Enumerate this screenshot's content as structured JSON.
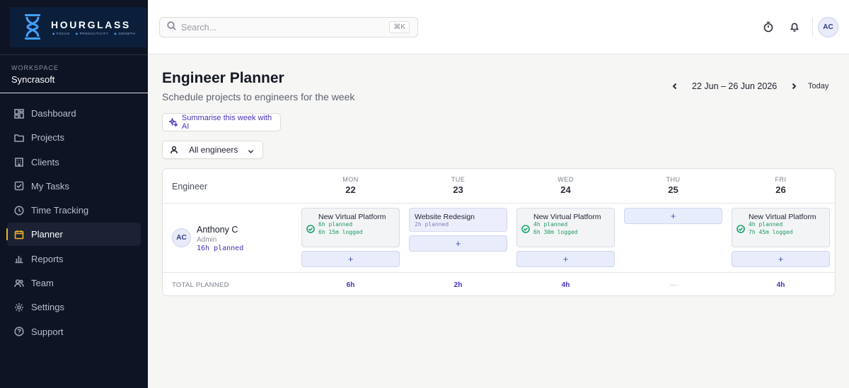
{
  "brand": {
    "name": "HOURGLASS",
    "taglines": [
      "FOCUS",
      "PRODUCTIVITY",
      "GROWTH"
    ]
  },
  "workspace": {
    "label": "WORKSPACE",
    "name": "Syncrasoft"
  },
  "nav": [
    {
      "label": "Dashboard",
      "icon": "dashboard-icon",
      "active": false
    },
    {
      "label": "Projects",
      "icon": "folder-icon",
      "active": false
    },
    {
      "label": "Clients",
      "icon": "building-icon",
      "active": false
    },
    {
      "label": "My Tasks",
      "icon": "checkbox-icon",
      "active": false
    },
    {
      "label": "Time Tracking",
      "icon": "clock-icon",
      "active": false
    },
    {
      "label": "Planner",
      "icon": "calendar-icon",
      "active": true
    },
    {
      "label": "Reports",
      "icon": "bar-chart-icon",
      "active": false
    },
    {
      "label": "Team",
      "icon": "users-icon",
      "active": false
    },
    {
      "label": "Settings",
      "icon": "gear-icon",
      "active": false
    },
    {
      "label": "Support",
      "icon": "help-icon",
      "active": false
    }
  ],
  "topbar": {
    "search_placeholder": "Search...",
    "shortcut": "⌘K",
    "avatar": "AC"
  },
  "page": {
    "title": "Engineer Planner",
    "subtitle": "Schedule projects to engineers for the week",
    "week_range": "22 Jun – 26 Jun 2026",
    "today_label": "Today",
    "ai_button": "Summarise this week with AI",
    "filter_label": "All engineers"
  },
  "grid": {
    "engineer_header": "Engineer",
    "days": [
      {
        "name": "MON",
        "date": "22"
      },
      {
        "name": "TUE",
        "date": "23"
      },
      {
        "name": "WED",
        "date": "24"
      },
      {
        "name": "THU",
        "date": "25"
      },
      {
        "name": "FRI",
        "date": "26"
      }
    ],
    "engineer": {
      "initials": "AC",
      "name": "Anthony C",
      "role": "Admin",
      "planned": "16h planned"
    },
    "cells": [
      {
        "title": "New Virtual Platform",
        "planned": "6h planned",
        "logged": "6h 15m logged"
      },
      {
        "title": "Website Redesign",
        "planned": "2h planned",
        "logged": ""
      },
      {
        "title": "New Virtual Platform",
        "planned": "4h planned",
        "logged": "6h 30m logged"
      },
      null,
      {
        "title": "New Virtual Platform",
        "planned": "4h planned",
        "logged": "7h 45m logged"
      }
    ],
    "add_label": "+",
    "total_label": "TOTAL PLANNED",
    "totals": [
      "6h",
      "2h",
      "4h",
      "—",
      "4h"
    ]
  },
  "colors": {
    "sidebar_bg": "#0f1424",
    "accent": "#4b2fb6",
    "active_marker": "#f0b429",
    "logged_green": "#1e9a62"
  }
}
